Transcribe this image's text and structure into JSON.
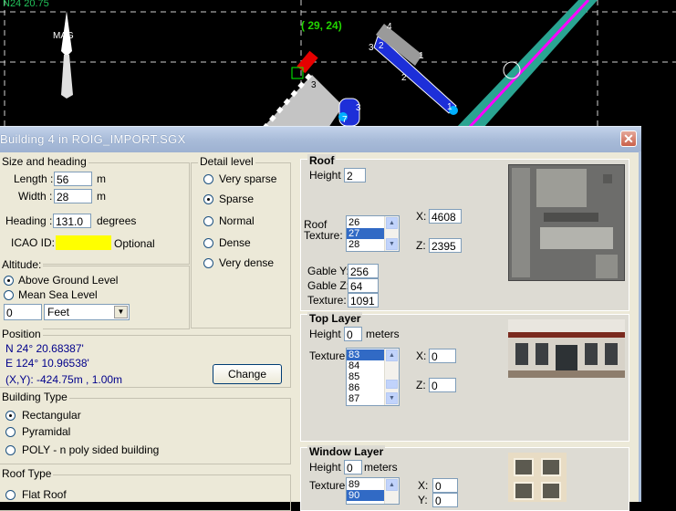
{
  "map": {
    "coord_label": "N24 20.75",
    "cursor_coord": "( 29, 24)",
    "mag_label": "MAG",
    "markers": [
      "4",
      "2",
      "3",
      "1",
      "2",
      "3",
      "7",
      "3",
      "1"
    ]
  },
  "dialog": {
    "title": "Building  4  in  ROIG_IMPORT.SGX",
    "close_symbol": "✕"
  },
  "size": {
    "group_title": "Size and heading",
    "length_label": "Length :",
    "length_value": "56",
    "width_label": "Width :",
    "width_value": "28",
    "unit_m": "m",
    "heading_label": "Heading :",
    "heading_value": "131.0",
    "heading_unit": "degrees",
    "icao_label": "ICAO ID:",
    "icao_value": "",
    "icao_color": "#ffff00",
    "optional_label": "Optional"
  },
  "detail": {
    "group_title": "Detail level",
    "options": [
      "Very sparse",
      "Sparse",
      "Normal",
      "Dense",
      "Very dense"
    ],
    "selected": "Sparse"
  },
  "altitude": {
    "group_title": "Altitude:",
    "options": [
      "Above Ground Level",
      "Mean Sea Level"
    ],
    "selected": "Above Ground Level",
    "value": "0",
    "unit": "Feet"
  },
  "position": {
    "group_title": "Position",
    "lat": "N  24° 20.68387'",
    "lon": "E 124° 10.96538'",
    "xy": "(X,Y):  -424.75m , 1.00m",
    "change_label": "Change"
  },
  "building_type": {
    "group_title": "Building Type",
    "options": [
      "Rectangular",
      "Pyramidal",
      "POLY - n poly sided building"
    ],
    "selected": "Rectangular"
  },
  "roof_type": {
    "group_title": "Roof Type",
    "options": [
      "Flat Roof"
    ]
  },
  "roof": {
    "title": "Roof",
    "height_label": "Height :",
    "height_value": "2",
    "texture_label_1": "Roof",
    "texture_label_2": "Texture:",
    "textures": [
      "26",
      "27",
      "28"
    ],
    "selected_texture": "27",
    "x_label": "X:",
    "x_value": "4608",
    "z_label": "Z:",
    "z_value": "2395",
    "gable_y_label": "Gable Y:",
    "gable_y_value": "256",
    "gable_z_label": "Gable Z:",
    "gable_z_value": "64",
    "gable_texture_label": "Texture:",
    "gable_texture_value": "1091"
  },
  "top_layer": {
    "title": "Top Layer",
    "height_label": "Height :",
    "height_value": "0",
    "height_unit": "meters",
    "texture_label": "Texture:",
    "textures": [
      "83",
      "84",
      "85",
      "86",
      "87"
    ],
    "selected_texture": "83",
    "x_label": "X:",
    "x_value": "0",
    "z_label": "Z:",
    "z_value": "0"
  },
  "window_layer": {
    "title": "Window Layer",
    "height_label": "Height :",
    "height_value": "0",
    "height_unit": "meters",
    "texture_label": "Texture:",
    "textures": [
      "89",
      "90"
    ],
    "selected_texture": "90",
    "x_label": "X:",
    "x_value": "0",
    "y_label": "Y:",
    "y_value": "0"
  }
}
